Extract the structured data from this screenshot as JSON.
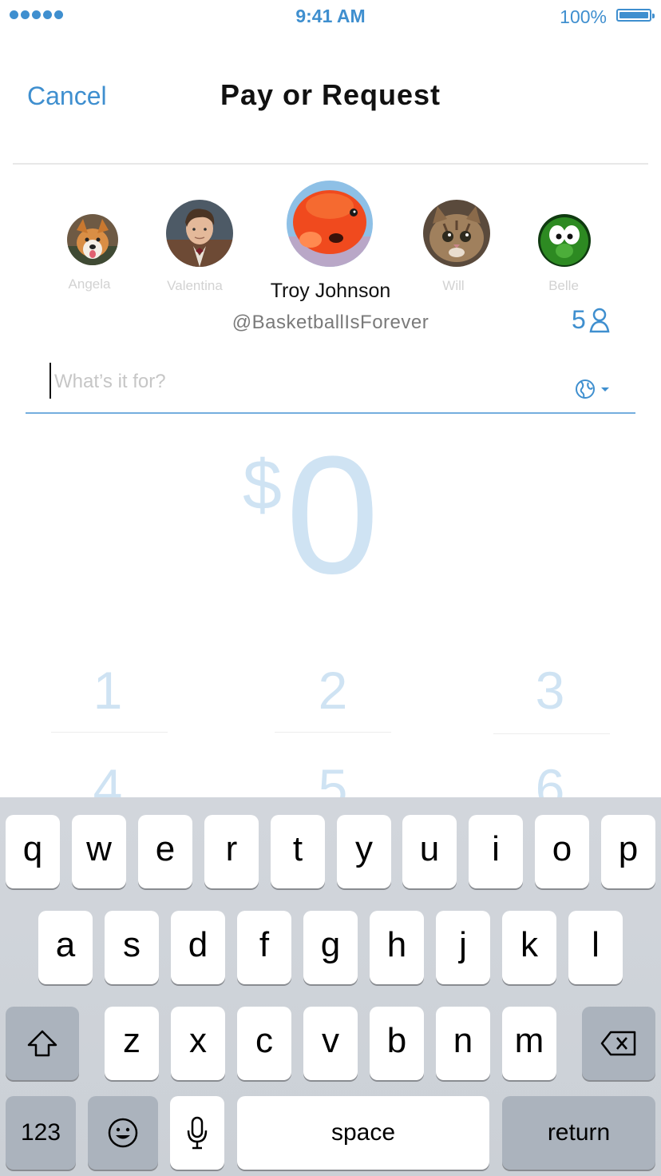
{
  "status_bar": {
    "time": "9:41 AM",
    "battery": "100%"
  },
  "nav": {
    "cancel_label": "Cancel",
    "title": "Pay or Request"
  },
  "contacts": [
    {
      "name": "Angela"
    },
    {
      "name": "Valentina"
    },
    {
      "name": "Troy Johnson",
      "handle": "@BasketballIsForever",
      "selected": true
    },
    {
      "name": "Will"
    },
    {
      "name": "Belle"
    }
  ],
  "group_count": "5",
  "note": {
    "placeholder": "What’s it for?",
    "value": "",
    "privacy_icon": "globe-icon"
  },
  "amount": {
    "currency": "$",
    "value": "0"
  },
  "numpad": {
    "keys": [
      "1",
      "2",
      "3",
      "4",
      "5",
      "6"
    ]
  },
  "keyboard": {
    "row1": [
      "q",
      "w",
      "e",
      "r",
      "t",
      "y",
      "u",
      "i",
      "o",
      "p"
    ],
    "row2": [
      "a",
      "s",
      "d",
      "f",
      "g",
      "h",
      "j",
      "k",
      "l"
    ],
    "row3": [
      "z",
      "x",
      "c",
      "v",
      "b",
      "n",
      "m"
    ],
    "numbers_label": "123",
    "space_label": "space",
    "return_label": "return"
  },
  "colors": {
    "accent": "#3f8fcf",
    "amount": "#cfe3f3",
    "keyboard_bg": "#d1d5db"
  }
}
